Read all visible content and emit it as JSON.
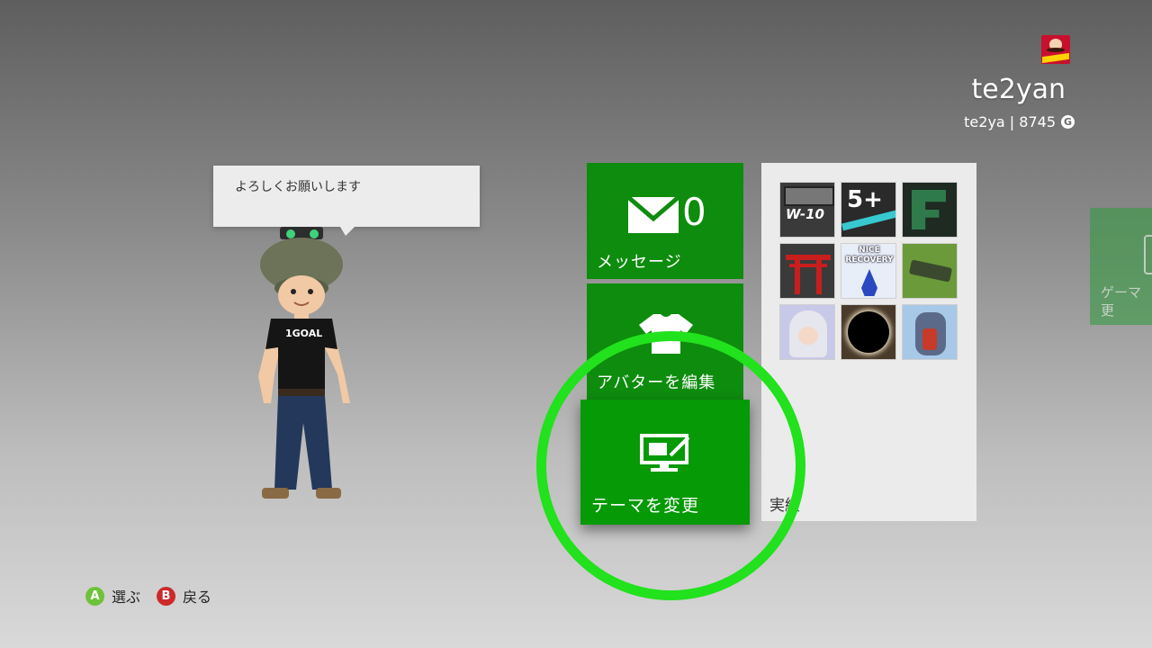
{
  "profile": {
    "gamertag": "te2yan",
    "subline": "te2ya | 8745",
    "gamerscore_icon": "G",
    "gamerpic": "pringles-gamerpic"
  },
  "status_message": "よろしくお願いします",
  "tiles": {
    "messages": {
      "label": "メッセージ",
      "count": "0",
      "icon": "envelope-icon"
    },
    "avatar": {
      "label": "アバターを編集",
      "icon": "tshirt-icon"
    },
    "theme": {
      "label": "テーマを変更",
      "icon": "monitor-brush-icon"
    },
    "side": {
      "label_line1": "ゲーマ",
      "label_line2": "更"
    }
  },
  "achievements": {
    "label": "実績",
    "items": [
      {
        "name": "w-10-badge",
        "text": "W-10"
      },
      {
        "name": "5-plus-badge",
        "text": "5+"
      },
      {
        "name": "f-badge",
        "text": "F"
      },
      {
        "name": "torii-badge",
        "text": ""
      },
      {
        "name": "nice-recovery-badge",
        "text": "NICE RECOVERY"
      },
      {
        "name": "tank-badge",
        "text": ""
      },
      {
        "name": "anime-girl-badge",
        "text": ""
      },
      {
        "name": "eclipse-badge",
        "text": ""
      },
      {
        "name": "mecha-girl-badge",
        "text": ""
      }
    ]
  },
  "hints": {
    "a_key": "A",
    "a_label": "選ぶ",
    "b_key": "B",
    "b_label": "戻る"
  },
  "colors": {
    "tile_green": "#0e8c0e",
    "selected_green": "#069a06",
    "highlight_ring": "#22e11d"
  }
}
